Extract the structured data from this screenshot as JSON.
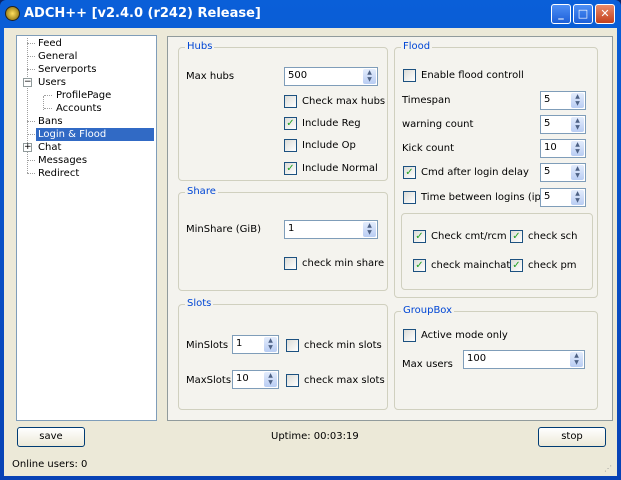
{
  "window": {
    "title": "ADCH++ [v2.4.0 (r242) Release]"
  },
  "tree": {
    "items": [
      "Feed",
      "General",
      "Serverports",
      "Users",
      "ProfilePage",
      "Accounts",
      "Bans",
      "Login & Flood",
      "Chat",
      "Messages",
      "Redirect"
    ],
    "selected": "Login & Flood"
  },
  "hubs": {
    "title": "Hubs",
    "max_hubs_label": "Max hubs",
    "max_hubs": "500",
    "check_max_hubs": "Check max hubs",
    "include_reg": "Include Reg",
    "include_op": "Include Op",
    "include_normal": "Include Normal",
    "checked": {
      "check_max_hubs": false,
      "include_reg": true,
      "include_op": false,
      "include_normal": true
    }
  },
  "share": {
    "title": "Share",
    "minshare_label": "MinShare (GiB)",
    "minshare": "1",
    "check_min_share": "check min share"
  },
  "slots": {
    "title": "Slots",
    "minslots_label": "MinSlots",
    "minslots": "1",
    "check_min_slots": "check min slots",
    "maxslots_label": "MaxSlots",
    "maxslots": "10",
    "check_max_slots": "check max slots"
  },
  "flood": {
    "title": "Flood",
    "enable": "Enable flood controll",
    "timespan_label": "Timespan",
    "timespan": "5",
    "warning_label": "warning count",
    "warning": "5",
    "kick_label": "Kick count",
    "kick": "10",
    "cmd_delay": "Cmd after login delay",
    "cmd_delay_value": "5",
    "time_between": "Time between logins (ip)",
    "time_between_value": "5",
    "check_cmt": "Check cmt/rcm",
    "check_sch": "check sch",
    "check_mainchat": "check mainchat",
    "check_pm": "check pm"
  },
  "groupbox": {
    "title": "GroupBox",
    "active_mode": "Active mode only",
    "max_users_label": "Max users",
    "max_users": "100"
  },
  "footer": {
    "save": "save",
    "uptime": "Uptime: 00:03:19",
    "stop": "stop",
    "status": "Online users: 0"
  }
}
